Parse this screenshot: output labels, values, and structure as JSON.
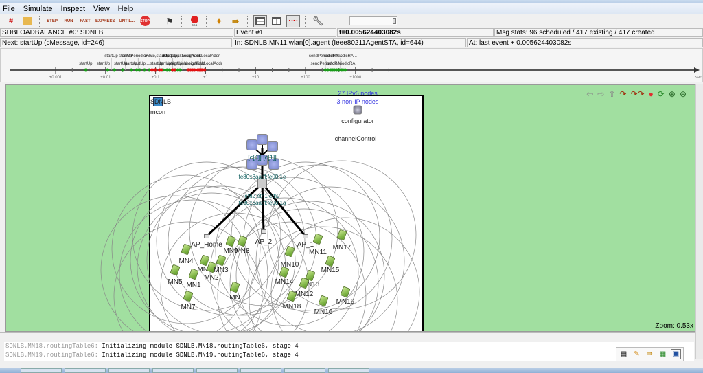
{
  "menu": [
    "File",
    "Simulate",
    "Inspect",
    "View",
    "Help"
  ],
  "toolbar": {
    "step": "STEP",
    "run": "RUN",
    "fast": "FAST",
    "express": "EXPRESS",
    "until": "UNTIL...",
    "stop": "STOP",
    "rec": "REC"
  },
  "status": {
    "network": "SDBLOADBALANCE #0: SDNLB",
    "event": "Event #1",
    "time": "t=0.005624403082s",
    "msgstats": "Msg stats: 96 scheduled / 417 existing / 417 created",
    "next": "Next: startUp (cMessage, id=246)",
    "in": "In: SDNLB.MN11.wlan[0].agent (Ieee80211AgentSTA, id=644)",
    "at": "At: last event + 0.005624403082s"
  },
  "timeline": {
    "unit": "sec",
    "ticks": [
      "+0.001",
      "+0.01",
      "+0.1",
      "+1",
      "+10",
      "+100",
      "+1000"
    ],
    "labels_top": [
      {
        "t": 0.013,
        "text": "startUp"
      },
      {
        "t": 0.025,
        "text": "startUp"
      },
      {
        "t": 0.045,
        "text": "sendPeriodicRA..."
      },
      {
        "t": 0.12,
        "text": "move,startUp,..."
      },
      {
        "t": 0.22,
        "text": "startUp,..."
      },
      {
        "t": 0.35,
        "text": "assignLinkLocalAddr..."
      },
      {
        "t": 0.8,
        "text": "assignLinkLocalAddr"
      },
      {
        "t": 250,
        "text": "sendPeriodicRA..."
      },
      {
        "t": 500,
        "text": "sendPeriodicRA..."
      }
    ],
    "labels_bottom": [
      {
        "t": 0.004,
        "text": "startUp"
      },
      {
        "t": 0.009,
        "text": "startUp"
      },
      {
        "t": 0.02,
        "text": "startUp"
      },
      {
        "t": 0.035,
        "text": "startUp,..."
      },
      {
        "t": 0.07,
        "text": "startUp,...startUp"
      },
      {
        "t": 0.15,
        "text": "startUp"
      },
      {
        "t": 0.25,
        "text": "startUp"
      },
      {
        "t": 0.4,
        "text": "assignLinkLocalAddr"
      },
      {
        "t": 0.9,
        "text": "assignLinkLocalAddr"
      },
      {
        "t": 250,
        "text": "sendPeriodicRA"
      },
      {
        "t": 500,
        "text": "sendPeriodicRA"
      }
    ],
    "events_green": [
      0.004,
      0.011,
      0.015,
      0.022,
      0.033,
      0.042,
      0.048,
      0.06,
      0.075,
      0.14,
      0.17,
      0.19,
      0.25,
      0.28,
      0.31,
      250,
      280,
      320,
      350,
      380,
      420,
      470,
      520,
      560,
      620
    ],
    "events_red": [
      0.085,
      0.095,
      0.1,
      0.12,
      0.13,
      0.22,
      0.24,
      0.45,
      0.5,
      0.55,
      0.6,
      0.7,
      0.75,
      0.8,
      0.85,
      0.95
    ]
  },
  "canvas": {
    "network_name": "SDNLB",
    "mcon": "mcon",
    "ipv6_nodes": "27 IPv6 nodes",
    "nonip_nodes": "3 non-IP nodes",
    "configurator": "configurator",
    "channel_control": "channelControl",
    "switch_ifaces": "eth2  eth1  eth0",
    "switch_addr": "fe80::8aa:ff:fe00:1a",
    "router_addr": "fe80::8aa:ff:fe00:1e",
    "router_labels": "[c[4]]  [c[1]]",
    "aps": [
      {
        "name": "AP_Home"
      },
      {
        "name": "AP_2"
      },
      {
        "name": "AP_1"
      }
    ],
    "mobiles": [
      {
        "name": "MN4"
      },
      {
        "name": "MN5"
      },
      {
        "name": "MN1"
      },
      {
        "name": "MN6"
      },
      {
        "name": "MN2"
      },
      {
        "name": "MN3"
      },
      {
        "name": "MN9"
      },
      {
        "name": "MN8"
      },
      {
        "name": "MN7"
      },
      {
        "name": "MN"
      },
      {
        "name": "MN10"
      },
      {
        "name": "MN14"
      },
      {
        "name": "MN11"
      },
      {
        "name": "MN17"
      },
      {
        "name": "MN15"
      },
      {
        "name": "MN13"
      },
      {
        "name": "MN12"
      },
      {
        "name": "MN18"
      },
      {
        "name": "MN16"
      },
      {
        "name": "MN19"
      }
    ],
    "zoom": "Zoom: 0.53x"
  },
  "log": [
    {
      "src": "SDNLB.MN18.routingTable6:",
      "msg": " Initializing module SDNLB.MN18.routingTable6, stage 4"
    },
    {
      "src": "SDNLB.MN19.routingTable6:",
      "msg": " Initializing module SDNLB.MN19.routingTable6, stage 4"
    }
  ]
}
